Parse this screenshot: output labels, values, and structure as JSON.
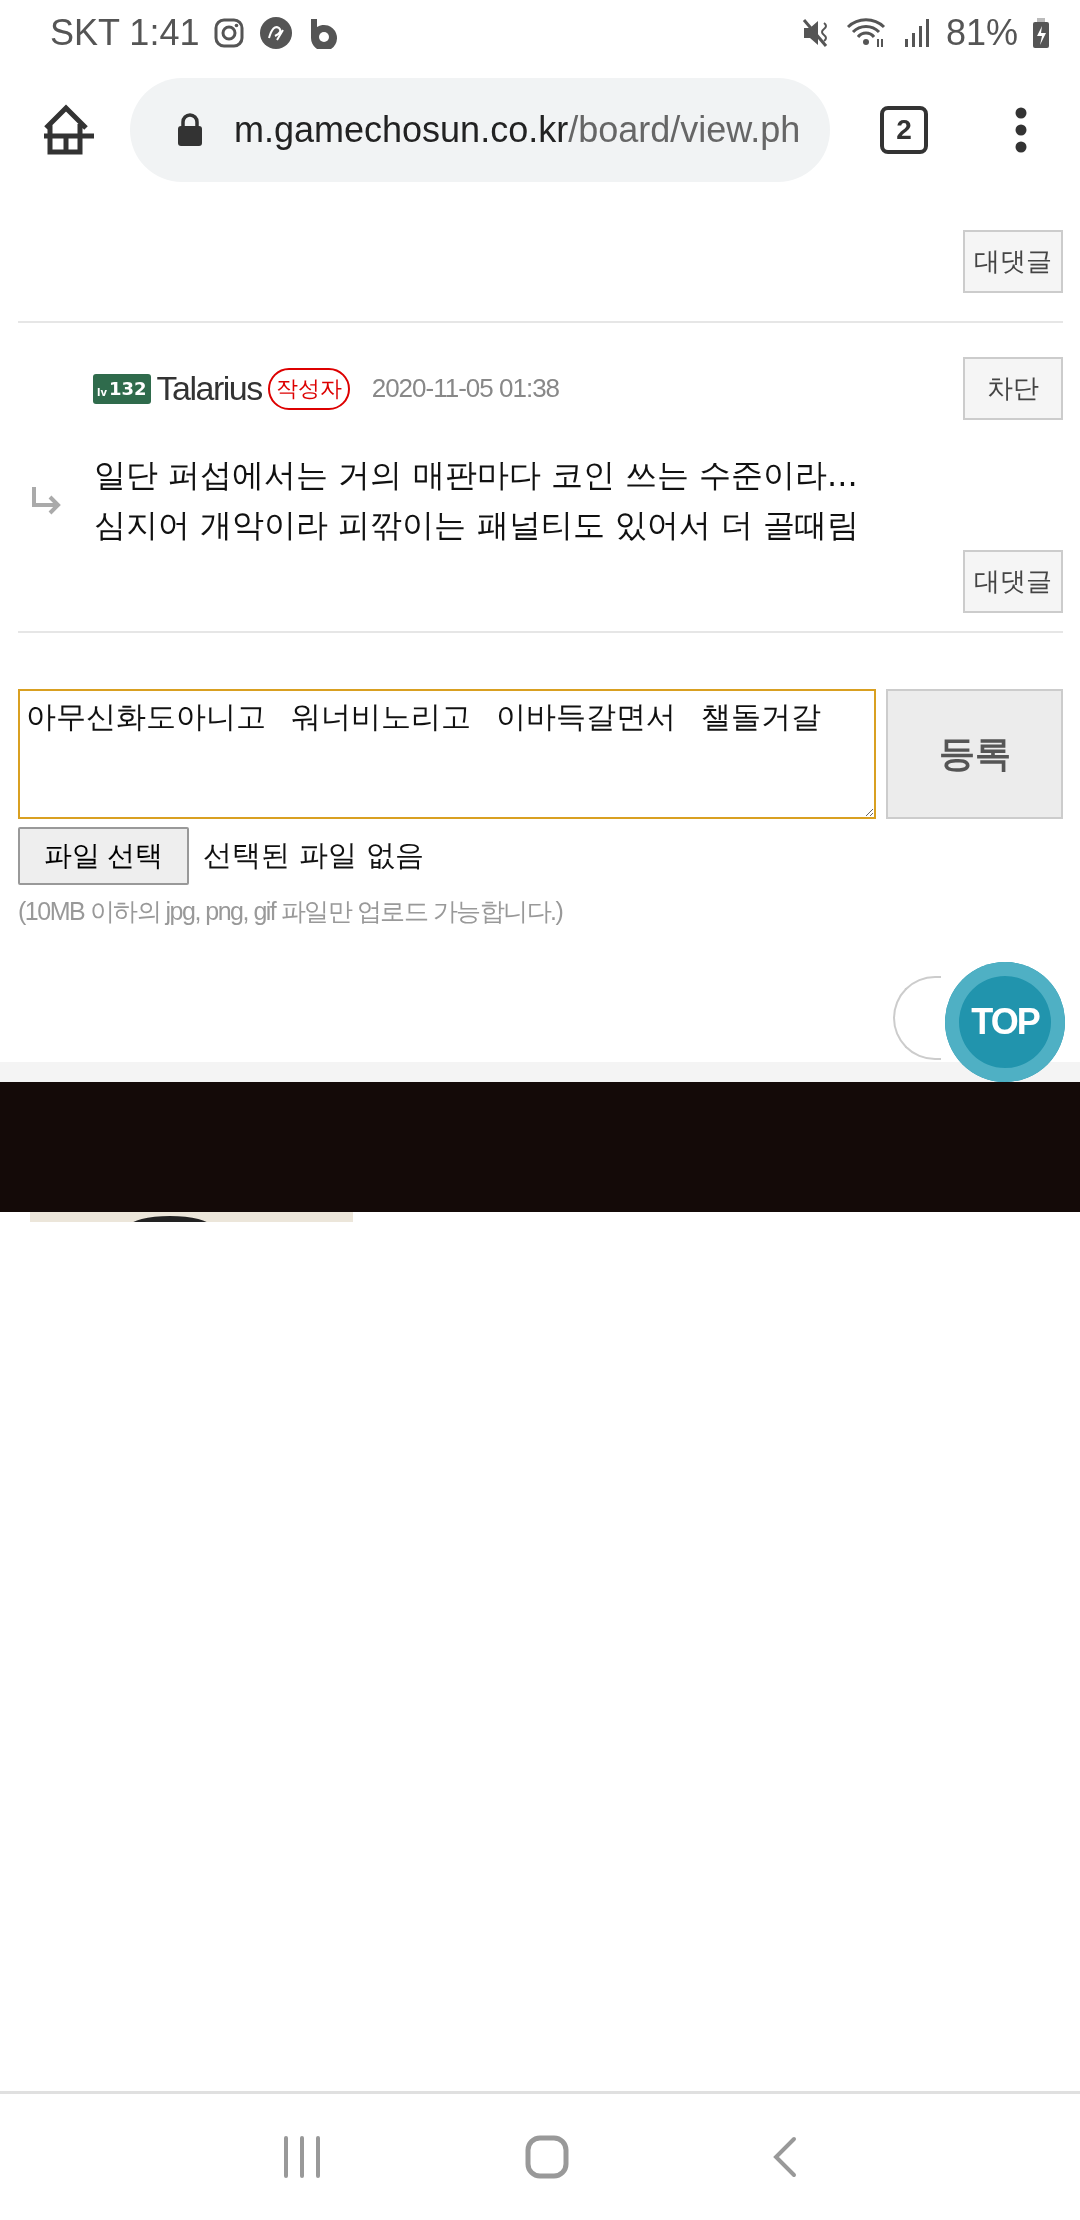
{
  "status_bar": {
    "carrier": "SKT",
    "time": "1:41",
    "battery": "81%"
  },
  "address_bar": {
    "host": "m.gamechosun.co.kr",
    "path": "/board/view.ph",
    "tab_count": "2"
  },
  "comments": [
    {
      "kind": "cut",
      "reply_button": "대댓글"
    },
    {
      "kind": "reply",
      "rank_badge": {
        "prefix": "lv",
        "number": "132"
      },
      "author": "Talarius",
      "author_badge": "작성자",
      "date": "2020-11-05 01:38",
      "block_button": "차단",
      "lines": [
        "일단 퍼섭에서는 거의 매판마다 코인 쓰는 수준이라...",
        "심지어 개악이라 피깎이는 패널티도 있어서 더 골때림"
      ],
      "reply_button": "대댓글"
    }
  ],
  "comment_form": {
    "value": "아무신화도아니고   워너비노리고   이바득갈면서   챌돌거갈",
    "focused": true,
    "submit": "등록",
    "file_button": "파일 선택",
    "file_status": "선택된 파일 없음",
    "hint": "(10MB 이하의 jpg, png, gif 파일만 업로드 가능합니다.)"
  },
  "top_button": "TOP"
}
